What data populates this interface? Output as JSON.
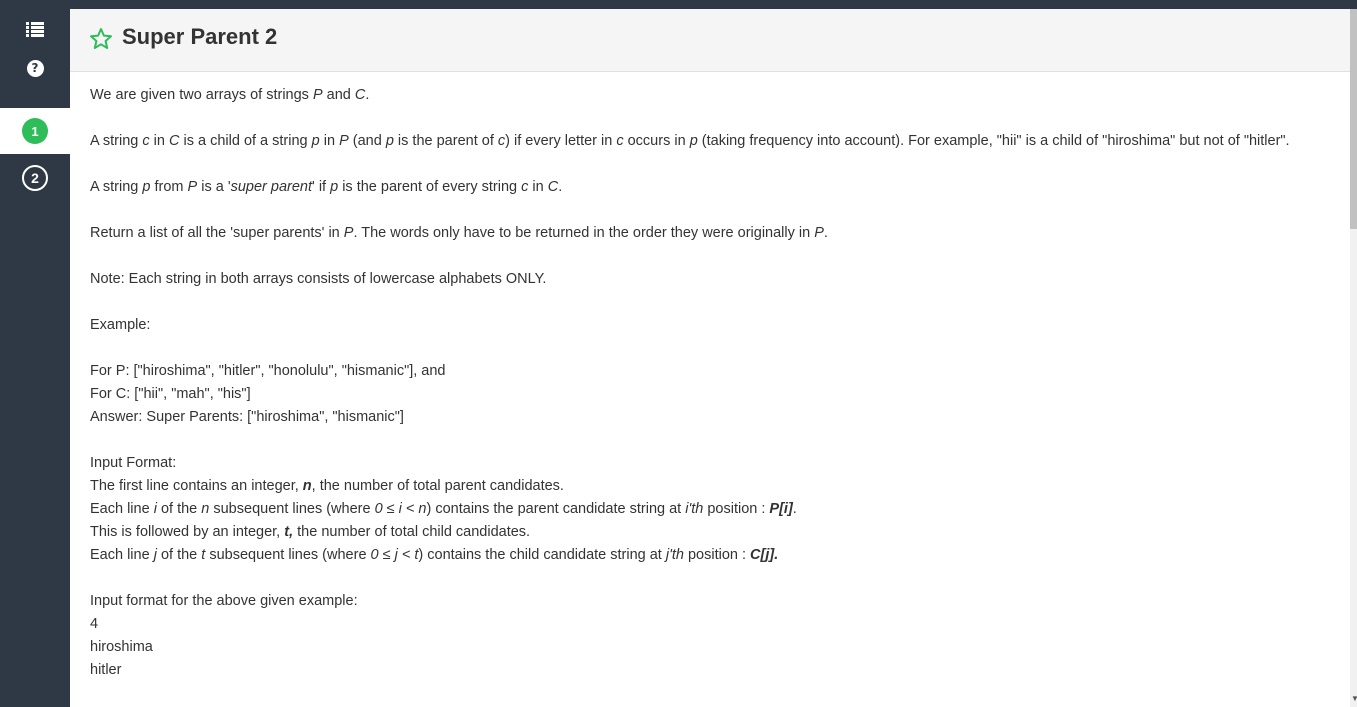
{
  "sidebar": {
    "menu_icon": "list-icon",
    "help_icon": "help-circle-icon",
    "help_glyph": "?",
    "questions": [
      {
        "number": "1",
        "active": true
      },
      {
        "number": "2",
        "active": false
      }
    ]
  },
  "header": {
    "star_icon": "star-outline-icon",
    "title": "Super Parent 2"
  },
  "content": {
    "p1": [
      "We are given two arrays of strings ",
      "P",
      " and ",
      "C",
      "."
    ],
    "p2": [
      "A string ",
      "c",
      " in ",
      "C",
      " is a child of a string ",
      "p",
      " in ",
      "P",
      " (and ",
      "p",
      " is the parent of ",
      "c",
      ") if every letter in ",
      "c",
      " occurs in ",
      "p",
      " (taking frequency into account). For example, \"hii\" is a child of \"hiroshima\" but not of \"hitler\"."
    ],
    "p3": [
      "A string ",
      "p",
      " from ",
      "P",
      " is a '",
      "super parent",
      "' if ",
      "p",
      " is the parent of every string ",
      "c",
      " in ",
      "C",
      "."
    ],
    "p4": [
      "Return a list of all the 'super parents' in ",
      "P",
      ". The words only have to be returned in the order they were originally in ",
      "P",
      "."
    ],
    "p5": "Note: Each string in both arrays consists of lowercase alphabets ONLY.",
    "p6": "Example:",
    "example": [
      "For P: [\"hiroshima\", \"hitler\", \"honolulu\", \"hismanic\"], and",
      "For C: [\"hii\", \"mah\", \"his\"]",
      "Answer: Super Parents: [\"hiroshima\", \"hismanic\"]"
    ],
    "input_format": {
      "heading": "Input Format:",
      "l1": [
        "The first line contains an integer, ",
        "n",
        ", the number of total parent candidates."
      ],
      "l2": [
        "Each line ",
        "i",
        " of the ",
        "n",
        " subsequent lines (where ",
        "0 ≤ i < n",
        ") contains the parent candidate string at ",
        "i'th",
        " position : ",
        "P[i]",
        "."
      ],
      "l3": [
        "This is followed by an integer, ",
        "t,",
        " the number of total child candidates."
      ],
      "l4": [
        "Each line ",
        "j",
        " of the ",
        "t",
        " subsequent lines (where ",
        "0 ≤ j < t",
        ") contains the child candidate string at ",
        "j'th",
        " position : ",
        "C[j]."
      ]
    },
    "example_input": {
      "heading": "Input format for the above given example:",
      "lines": [
        "4",
        "hiroshima",
        "hitler"
      ]
    }
  }
}
